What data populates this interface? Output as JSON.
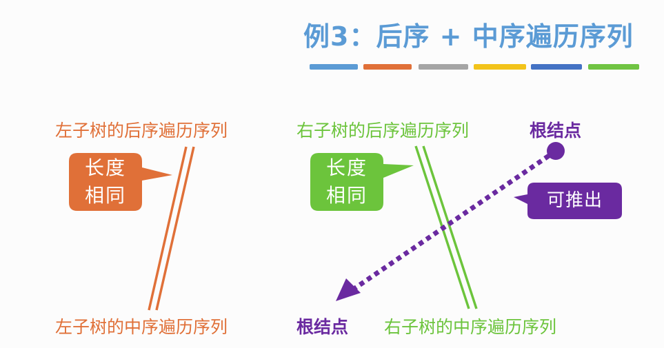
{
  "title": "例3：后序 + 中序遍历序列",
  "colors": {
    "title": "#5b9bd5",
    "orange": "#e07038",
    "green": "#6cc43c",
    "purple": "#6a2aa0",
    "bars": [
      "#5b9bd5",
      "#e07038",
      "#a5a5a5",
      "#f2c31a",
      "#4472c4",
      "#70c443"
    ]
  },
  "labels": {
    "left_post": "左子树的后序遍历序列",
    "right_post": "右子树的后序遍历序列",
    "root_top": "根结点",
    "left_in": "左子树的中序遍历序列",
    "root_bottom": "根结点",
    "right_in": "右子树的中序遍历序列"
  },
  "callouts": {
    "left": {
      "line1": "长度",
      "line2": "相同"
    },
    "right": {
      "line1": "长度",
      "line2": "相同"
    },
    "infer": "可推出"
  }
}
